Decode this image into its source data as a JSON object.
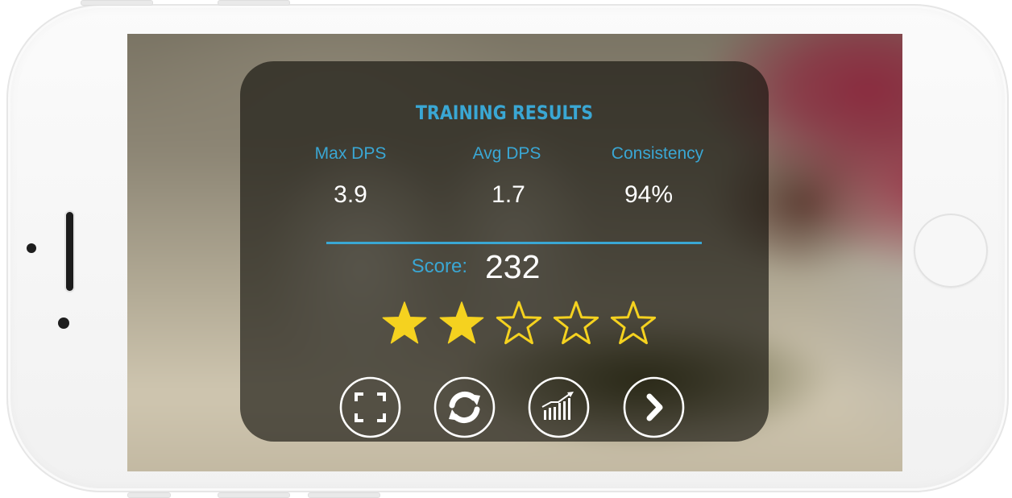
{
  "results": {
    "title": "TRAINING RESULTS",
    "stats": [
      {
        "label": "Max DPS",
        "value": "3.9"
      },
      {
        "label": "Avg DPS",
        "value": "1.7"
      },
      {
        "label": "Consistency",
        "value": "94%"
      }
    ],
    "score_label": "Score:",
    "score_value": "232",
    "rating": {
      "filled": 2,
      "total": 5
    },
    "actions": [
      {
        "icon": "fullscreen-icon"
      },
      {
        "icon": "refresh-icon"
      },
      {
        "icon": "bar-chart-icon"
      },
      {
        "icon": "chevron-right-icon"
      }
    ]
  },
  "colors": {
    "accent": "#3aa7d4",
    "star_fill": "#f5d21f",
    "text": "#ffffff",
    "panel": "#16130d"
  }
}
